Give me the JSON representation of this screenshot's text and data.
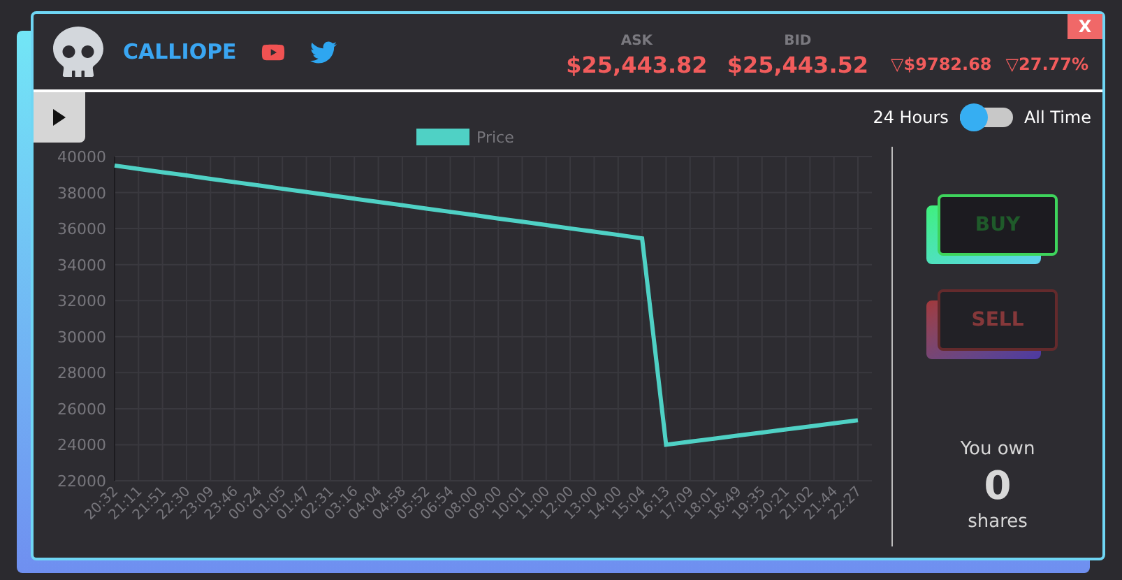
{
  "header": {
    "name": "CALLIOPE",
    "ask": {
      "label": "ASK",
      "value": "$25,443.82"
    },
    "bid": {
      "label": "BID",
      "value": "$25,443.52"
    },
    "changes": [
      {
        "arrow": "▽",
        "value": "$9782.68"
      },
      {
        "arrow": "▽",
        "value": "27.77%"
      }
    ],
    "close": "X"
  },
  "range": {
    "left": "24 Hours",
    "right": "All Time",
    "on": false
  },
  "chart_data": {
    "type": "line",
    "categories": [
      "20:32",
      "21:11",
      "21:51",
      "22:30",
      "23:09",
      "23:46",
      "00:24",
      "01:05",
      "01:47",
      "02:31",
      "03:16",
      "04:04",
      "04:58",
      "05:52",
      "06:54",
      "08:00",
      "09:00",
      "10:01",
      "11:00",
      "12:00",
      "13:00",
      "14:00",
      "15:04",
      "16:13",
      "17:09",
      "18:01",
      "18:49",
      "19:35",
      "20:21",
      "21:02",
      "21:44",
      "22:27"
    ],
    "series": [
      {
        "name": "Price",
        "color": "#4fd1c5",
        "values": [
          39500,
          39310,
          39130,
          38950,
          38760,
          38580,
          38400,
          38210,
          38030,
          37850,
          37660,
          37480,
          37300,
          37110,
          36930,
          36750,
          36560,
          36380,
          36200,
          36010,
          35830,
          35650,
          35460,
          24000,
          24170,
          24340,
          24510,
          24680,
          24850,
          25020,
          25190,
          25360
        ]
      }
    ],
    "ylim": [
      22000,
      40000
    ],
    "grid": true,
    "yticks": [
      22000,
      24000,
      26000,
      28000,
      30000,
      32000,
      34000,
      36000,
      38000,
      40000
    ]
  },
  "trade": {
    "buy": {
      "label": "BUY",
      "disabled": false
    },
    "sell": {
      "label": "SELL",
      "disabled": true
    }
  },
  "holdings": {
    "prefix": "You own",
    "count": "0",
    "suffix": "shares"
  }
}
